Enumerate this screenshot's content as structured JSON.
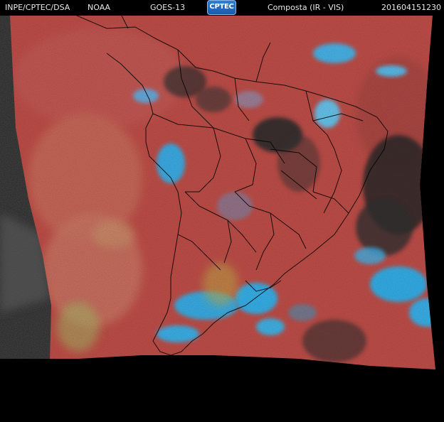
{
  "header": {
    "agency": "INPE/CPTEC/DSA",
    "source": "NOAA",
    "satellite": "GOES-13",
    "logo_text": "CPTEC",
    "product": "Composta (IR - VIS)",
    "timestamp": "201604151230"
  },
  "colors": {
    "ocean_warm": "#c8524a",
    "land_red": "#b8463e",
    "cloud_cyan": "#34b6ec",
    "space_gray": "#3a3a3a",
    "dark_patch": "#2e2e2e",
    "borders": "#000000"
  }
}
